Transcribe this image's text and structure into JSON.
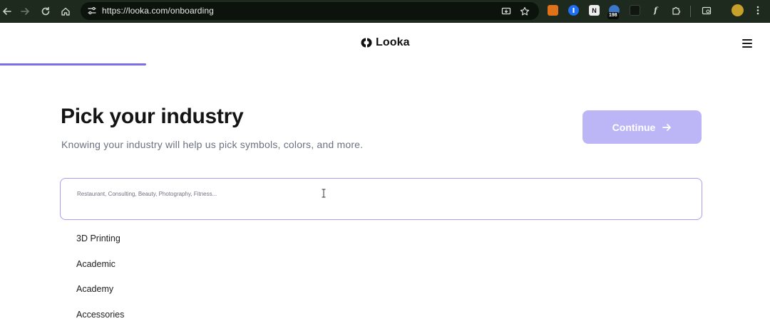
{
  "browser": {
    "url": "https://looka.com/onboarding",
    "extension_badge": "198"
  },
  "header": {
    "brand_name": "Looka"
  },
  "onboarding": {
    "progress": 0.19,
    "title": "Pick your industry",
    "subtitle": "Knowing your industry will help us pick symbols, colors, and more.",
    "continue_label": "Continue"
  },
  "search": {
    "placeholder": "Restaurant, Consulting, Beauty, Photography, Fitness...",
    "value": ""
  },
  "industries": [
    {
      "label": "3D Printing"
    },
    {
      "label": "Academic"
    },
    {
      "label": "Academy"
    },
    {
      "label": "Accessories"
    }
  ],
  "colors": {
    "accent": "#7b6fe8",
    "continue_disabled": "#bcb6f7",
    "search_border": "#a79ff2"
  }
}
